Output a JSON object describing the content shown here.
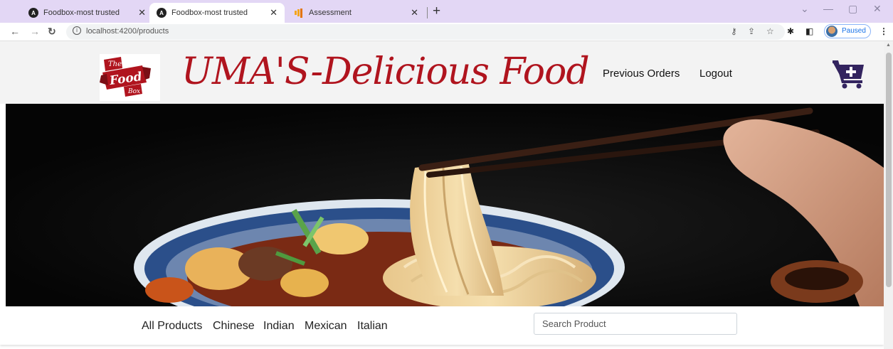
{
  "browser": {
    "tabs": [
      {
        "title": "Foodbox-most trusted",
        "active": false,
        "favicon": "angular-icon"
      },
      {
        "title": "Foodbox-most trusted",
        "active": true,
        "favicon": "angular-icon"
      },
      {
        "title": "Assessment",
        "active": false,
        "favicon": "analytics-icon"
      }
    ],
    "url": "localhost:4200/products",
    "profile_status": "Paused"
  },
  "header": {
    "brand_title": "UMA'S-Delicious Food",
    "logo_text": {
      "line1": "The",
      "line2": "Food",
      "line3": "Box"
    },
    "nav": [
      {
        "label": "Previous Orders"
      },
      {
        "label": "Logout"
      }
    ],
    "cart_icon": "cart-plus-icon"
  },
  "categories": [
    "All Products",
    "Chinese",
    "Indian",
    "Mexican",
    "Italian"
  ],
  "search": {
    "placeholder": "Search Product",
    "value": ""
  },
  "colors": {
    "brand_red": "#b0141e",
    "cart_purple": "#33245f",
    "tabbar": "#e3d7f5"
  }
}
